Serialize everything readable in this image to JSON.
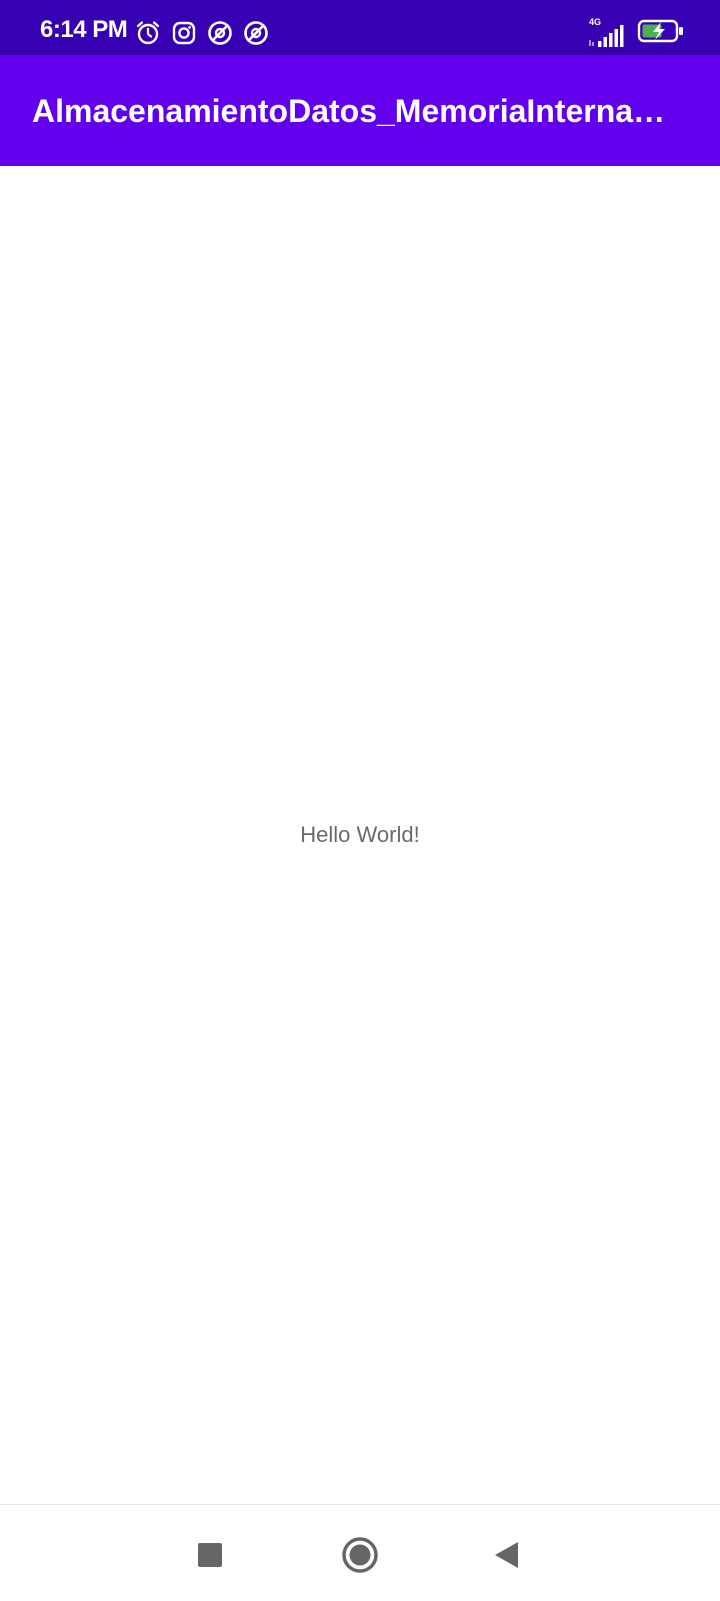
{
  "status_bar": {
    "time": "6:14 PM",
    "network_type": "4G",
    "icons": [
      "alarm-icon",
      "instagram-icon",
      "app-notification-icon",
      "app-notification-icon",
      "signal-icon",
      "battery-charging-icon"
    ],
    "colors": {
      "background": "#3700b3",
      "battery_fill": "#4caf50"
    }
  },
  "app_bar": {
    "title": "AlmacenamientoDatos_MemoriaInterna_A...",
    "colors": {
      "background": "#6200ee",
      "text": "#ffffff"
    }
  },
  "content": {
    "message": "Hello World!"
  },
  "nav_bar": {
    "buttons": [
      "recents-button",
      "home-button",
      "back-button"
    ],
    "colors": {
      "icon": "#666666"
    }
  }
}
